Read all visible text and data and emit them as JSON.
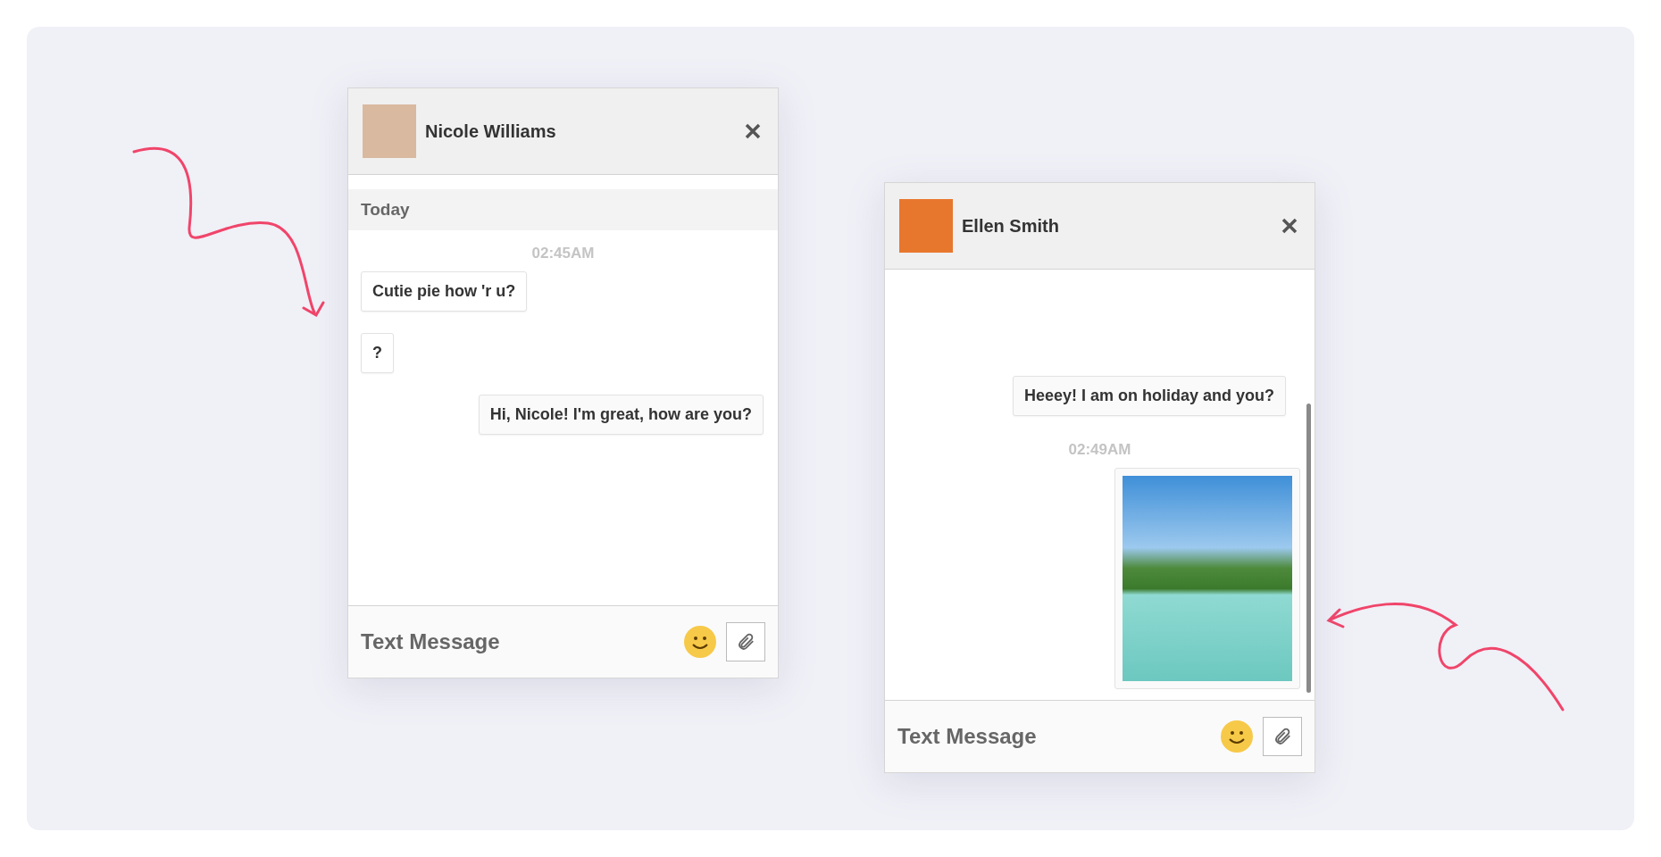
{
  "chat_windows": [
    {
      "contact": {
        "name": "Nicole Williams"
      },
      "scrollable": false,
      "messages": [
        {
          "kind": "date",
          "text": "Today"
        },
        {
          "kind": "time",
          "text": "02:45AM"
        },
        {
          "kind": "received",
          "text": "Cutie pie how 'r u?"
        },
        {
          "kind": "received",
          "text": "?"
        },
        {
          "kind": "sent",
          "text": "Hi, Nicole! I'm great, how are you?"
        }
      ],
      "composer": {
        "placeholder": "Text Message"
      }
    },
    {
      "contact": {
        "name": "Ellen Smith"
      },
      "scrollable": true,
      "messages": [
        {
          "kind": "sent",
          "text": "Heeey! I am on holiday and you?"
        },
        {
          "kind": "time",
          "text": "02:49AM"
        },
        {
          "kind": "image"
        }
      ],
      "composer": {
        "placeholder": "Text Message"
      }
    }
  ]
}
